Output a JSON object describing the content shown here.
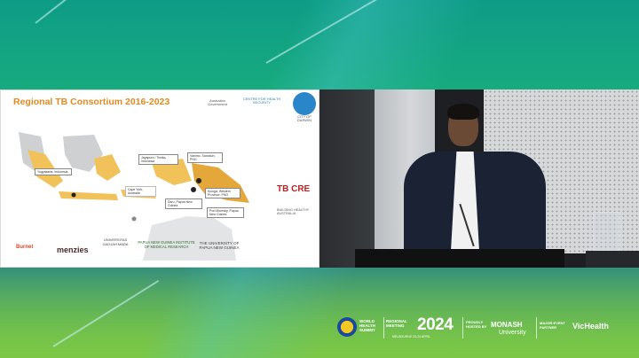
{
  "slide": {
    "title": "Regional TB Consortium 2016-2023",
    "logos": {
      "australian_government": "Australian Government",
      "centre_health_security": "CENTRE FOR HEALTH SECURITY",
      "city_hub": "CITY OF DARWIN"
    },
    "map_callouts": [
      "Yogyakarta, Indonesia",
      "Jayapura / Timika, Indonesia",
      "Vanimo, Sandaun, PNG",
      "Kiunga, Western Province, PNG",
      "Daru, Papua New Guinea",
      "Port Moresby, Papua New Guinea",
      "Cape York, Australia"
    ],
    "partners": {
      "burnet": "Burnet",
      "menzies": "menzies",
      "ugm": "UNIVERSITAS GADJAH MADA",
      "pngimr": "PAPUA NEW GUINEA INSTITUTE OF MEDICAL RESEARCH",
      "upng": "THE UNIVERSITY OF PAPUA NEW GUINEA",
      "tbcre": "TB CRE",
      "bha": "BUILDING HEALTHY AUSTRALIA"
    }
  },
  "footer": {
    "whs": "WORLD HEALTH SUMMIT",
    "regional_meeting": "REGIONAL MEETING",
    "year": "2024",
    "dates": "MELBOURNE 23-24 APRIL",
    "proudly_hosted": "PROUDLY HOSTED BY",
    "monash": "MONASH",
    "monash_sub": "University",
    "major_partner": "MAJOR EVENT PARTNER",
    "vichealth": "VicHealth"
  },
  "colors": {
    "title_orange": "#e08b22",
    "map_yellow": "#f1c15a",
    "map_gray": "#cfd0d2"
  }
}
